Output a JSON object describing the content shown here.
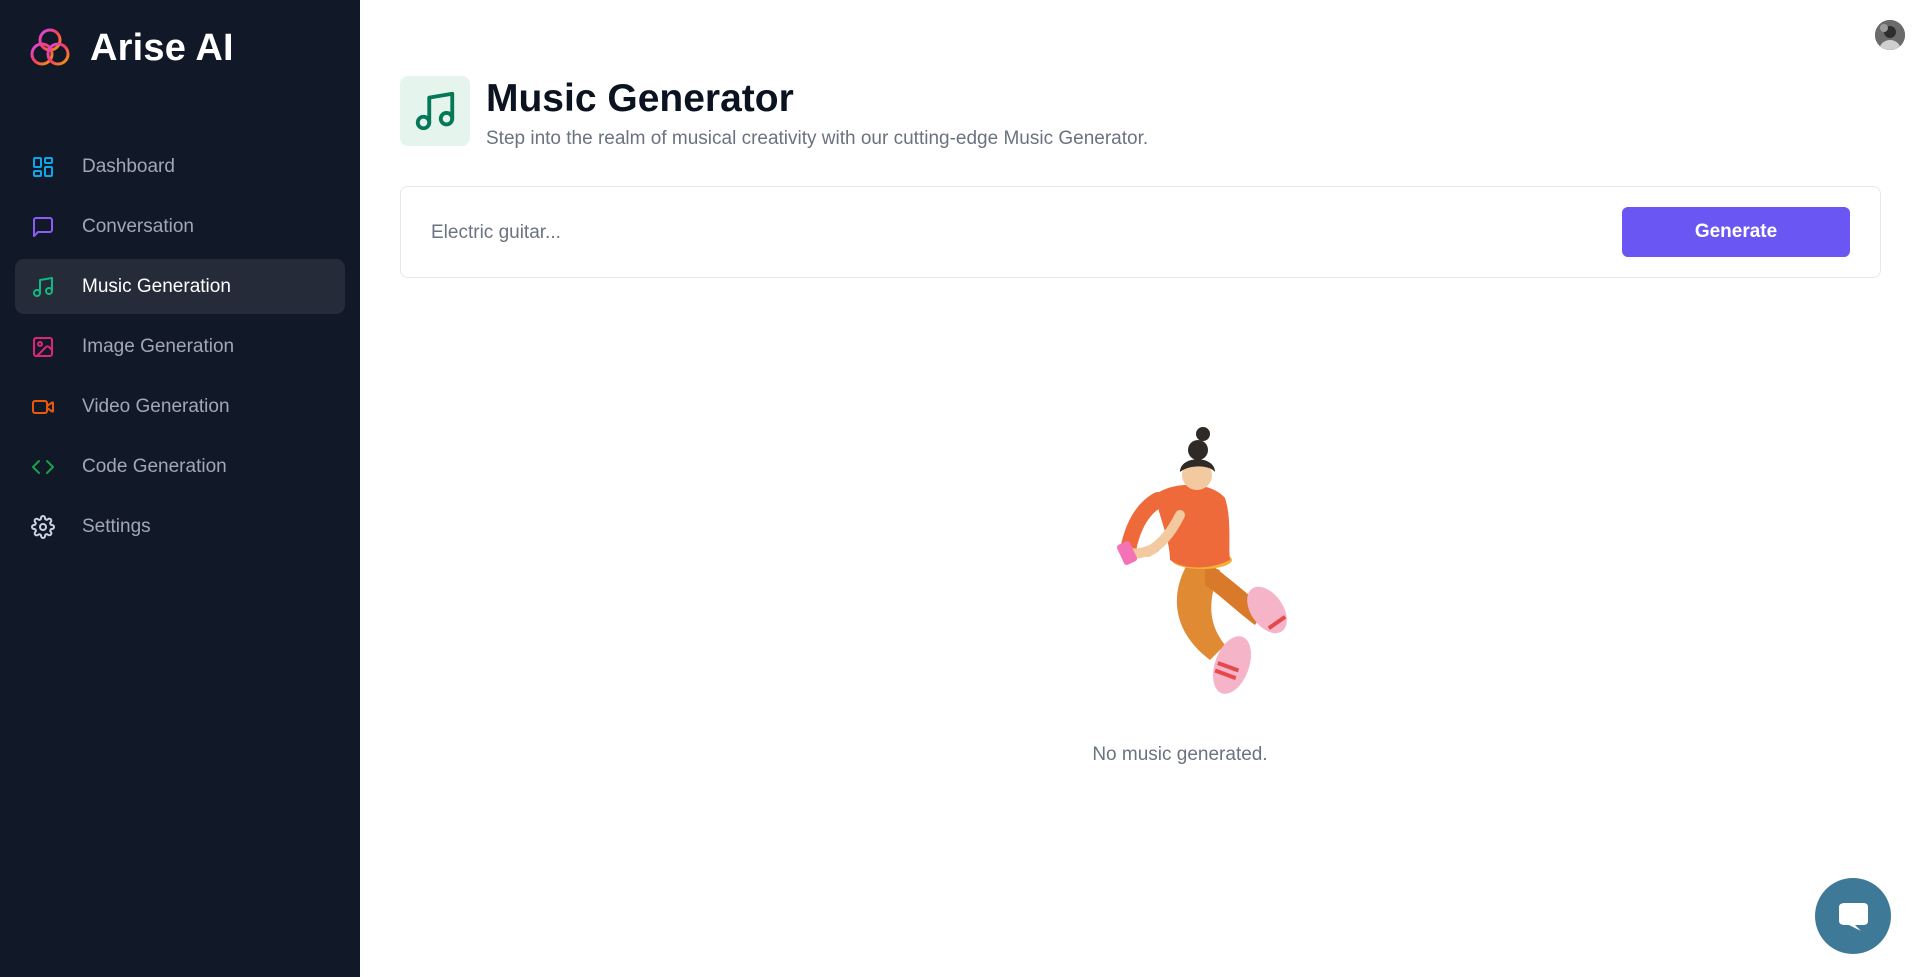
{
  "brand": {
    "name": "Arise AI",
    "logo_icon": "rings-logo-icon"
  },
  "sidebar": {
    "items": [
      {
        "label": "Dashboard",
        "icon": "dashboard-icon",
        "color": "#0ea5e9",
        "active": false
      },
      {
        "label": "Conversation",
        "icon": "message-square-icon",
        "color": "#8b5cf6",
        "active": false
      },
      {
        "label": "Music Generation",
        "icon": "music-icon",
        "color": "#10b981",
        "active": true
      },
      {
        "label": "Image Generation",
        "icon": "image-icon",
        "color": "#db2777",
        "active": false
      },
      {
        "label": "Video Generation",
        "icon": "video-icon",
        "color": "#ea580c",
        "active": false
      },
      {
        "label": "Code Generation",
        "icon": "code-icon",
        "color": "#16a34a",
        "active": false
      },
      {
        "label": "Settings",
        "icon": "gear-icon",
        "color": "#d1d5db",
        "active": false
      }
    ]
  },
  "header": {
    "title": "Music Generator",
    "subtitle": "Step into the realm of musical creativity with our cutting-edge Music Generator.",
    "icon": "music-icon",
    "icon_color": "#047857",
    "icon_bg": "#e6f4ee"
  },
  "prompt": {
    "placeholder": "Electric guitar...",
    "value": "",
    "button_label": "Generate",
    "button_color": "#6a56f2"
  },
  "empty_state": {
    "message": "No music generated.",
    "illustration": "floating-person-with-phone"
  },
  "chat_widget": {
    "icon": "chat-bubble-icon",
    "color": "#3f7998"
  },
  "user": {
    "avatar": "user-avatar"
  }
}
